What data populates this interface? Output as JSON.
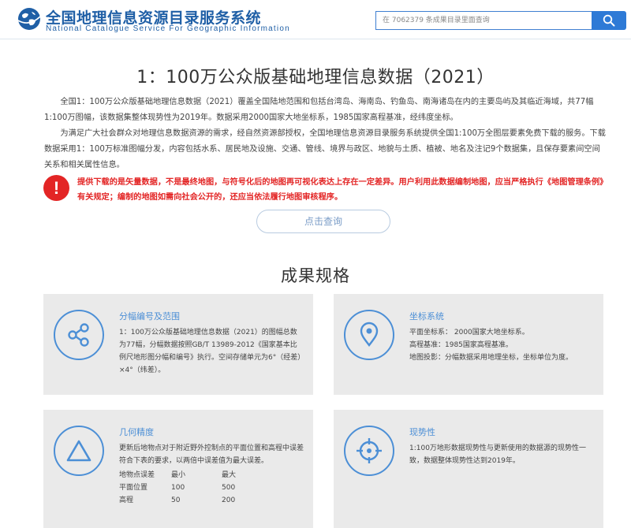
{
  "header": {
    "title": "全国地理信息资源目录服务系统",
    "subtitle": "National Catalogue Service For Geographic Information",
    "search_placeholder": "在 7062379 条成果目录里面查询",
    "search_icon": "search-icon"
  },
  "main": {
    "title": "1：100万公众版基础地理信息数据（2021）",
    "intro": [
      "全国1：100万公众版基础地理信息数据（2021）覆盖全国陆地范围和包括台湾岛、海南岛、钓鱼岛、南海诸岛在内的主要岛屿及其临近海域，共77幅1:100万图幅，该数据集整体现势性为2019年。数据采用2000国家大地坐标系，1985国家高程基准，经纬度坐标。",
      "为满足广大社会群众对地理信息数据资源的需求，经自然资源部授权，全国地理信息资源目录服务系统提供全国1:100万全图层要素免费下载的服务。下载数据采用1：100万标准图幅分发，内容包括水系、居民地及设施、交通、管线、境界与政区、地貌与土质、植被、地名及注记9个数据集，且保存要素间空间关系和相关属性信息。"
    ],
    "warning": "提供下载的是矢量数据，不是最终地图，与符号化后的地图再可视化表达上存在一定差异。用户利用此数据编制地图，应当严格执行《地图管理条例》有关规定；编制的地图如需向社会公开的，还应当依法履行地图审核程序。",
    "query_button": "点击查询"
  },
  "specs": {
    "title": "成果规格",
    "cards": [
      {
        "title": "分幅编号及范围",
        "icon": "share-icon",
        "body": "1：100万公众版基础地理信息数据（2021）的图幅总数为77幅，分幅数据按照GB/T 13989-2012《国家基本比例尺地形图分幅和编号》执行。空间存储单元为6°（经差）×4°（纬差）。"
      },
      {
        "title": "坐标系统",
        "icon": "location-pin-icon",
        "lines": [
          "平面坐标系：  2000国家大地坐标系。",
          "高程基准：1985国家高程基准。",
          "地图投影：分幅数据采用地理坐标，坐标单位为度。"
        ]
      },
      {
        "title": "几何精度",
        "icon": "triangle-icon",
        "body": "更新后地物点对于附近野外控制点的平面位置和高程中误差符合下表的要求，以两倍中误差值为最大误差。",
        "table": {
          "header": [
            "地物点误差",
            "最小",
            "最大"
          ],
          "rows": [
            [
              "平面位置",
              "100",
              "500"
            ],
            [
              "高程",
              "50",
              "200"
            ]
          ]
        }
      },
      {
        "title": "现势性",
        "icon": "crosshair-icon",
        "body": "1:100万地形数据现势性与更新使用的数据源的现势性一致，数据整体现势性达到2019年。"
      }
    ]
  },
  "colors": {
    "brand_blue": "#1f5fa6",
    "accent_blue": "#4c8fd6",
    "warning_red": "#e32525",
    "card_bg": "#eaeaea"
  }
}
